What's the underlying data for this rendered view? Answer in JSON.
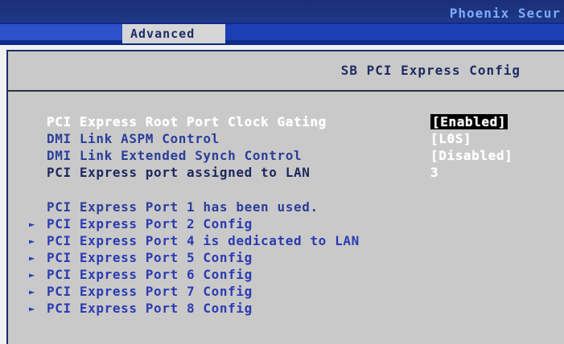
{
  "header": {
    "vendor": "Phoenix Secur",
    "tabs": [
      {
        "label": "Advanced"
      }
    ]
  },
  "panel": {
    "title": "SB PCI Express Config",
    "settings": [
      {
        "label": "PCI Express Root Port Clock Gating",
        "value": "[Enabled]"
      },
      {
        "label": "DMI Link ASPM Control",
        "value": "[L0S]"
      },
      {
        "label": "DMI Link Extended Synch Control",
        "value": "[Disabled]"
      },
      {
        "label": "PCI Express port assigned to LAN",
        "value": "3"
      }
    ],
    "info": {
      "label": "PCI Express Port 1 has been used."
    },
    "submenus": [
      {
        "label": "PCI Express Port 2 Config"
      },
      {
        "label": "PCI Express Port 4 is dedicated to LAN"
      },
      {
        "label": "PCI Express Port 5 Config"
      },
      {
        "label": "PCI Express Port 6 Config"
      },
      {
        "label": "PCI Express Port 7 Config"
      },
      {
        "label": "PCI Express Port 8 Config"
      }
    ],
    "arrow_glyph": "►"
  }
}
